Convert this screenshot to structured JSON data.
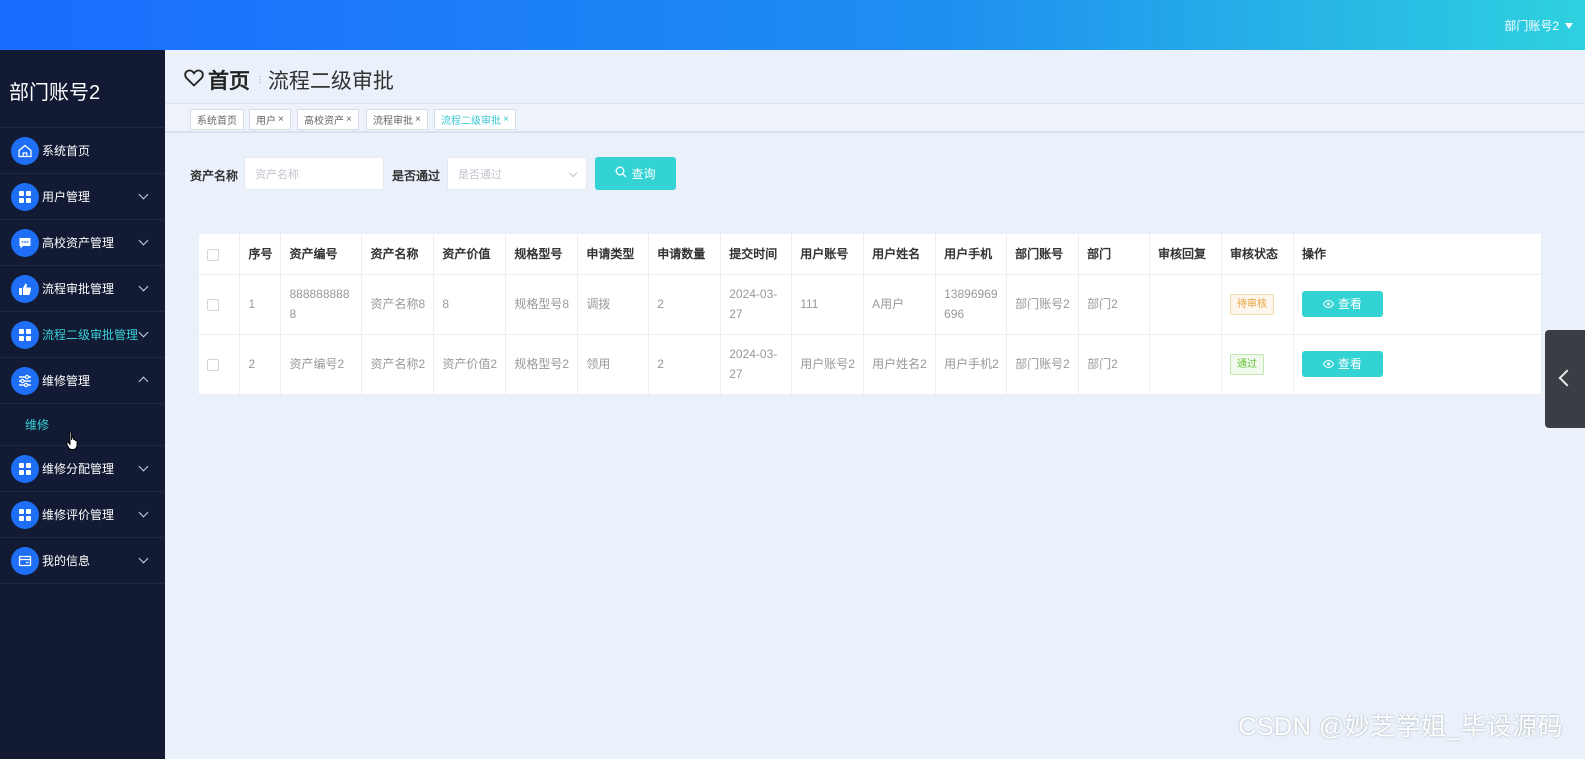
{
  "header": {
    "user": "部门账号2"
  },
  "sidebar": {
    "brand": "部门账号2",
    "items": [
      {
        "label": "系统首页",
        "icon": "home-icon"
      },
      {
        "label": "用户管理",
        "icon": "grid-icon"
      },
      {
        "label": "高校资产管理",
        "icon": "chat-icon"
      },
      {
        "label": "流程审批管理",
        "icon": "thumbs-up-icon"
      },
      {
        "label": "流程二级审批管理",
        "icon": "grid-icon"
      },
      {
        "label": "维修管理",
        "icon": "sliders-icon"
      },
      {
        "label": "维修分配管理",
        "icon": "grid-icon"
      },
      {
        "label": "维修评价管理",
        "icon": "grid-icon"
      },
      {
        "label": "我的信息",
        "icon": "card-icon"
      }
    ],
    "sub_item": "维修"
  },
  "breadcrumb": {
    "home": "首页",
    "current": "流程二级审批"
  },
  "tabs": [
    "系统首页",
    "用户",
    "高校资产",
    "流程审批",
    "流程二级审批"
  ],
  "search": {
    "asset_name_label": "资产名称",
    "asset_name_placeholder": "资产名称",
    "pass_label": "是否通过",
    "pass_placeholder": "是否通过",
    "query_label": "查询"
  },
  "table": {
    "columns": [
      "序号",
      "资产编号",
      "资产名称",
      "资产价值",
      "规格型号",
      "申请类型",
      "申请数量",
      "提交时间",
      "用户账号",
      "用户姓名",
      "用户手机",
      "部门账号",
      "部门",
      "审核回复",
      "审核状态",
      "操作"
    ],
    "rows": [
      {
        "no": "1",
        "asset_code": "8888888888",
        "asset_name": "资产名称8",
        "asset_value": "8",
        "spec": "规格型号8",
        "apply_type": "调拨",
        "qty": "2",
        "submit_time": "2024-03-27",
        "user_account": "111",
        "user_name": "A用户",
        "phone": "13896969696",
        "dept_account": "部门账号2",
        "dept": "部门2",
        "reply": "",
        "status": "待审核",
        "action": "查看"
      },
      {
        "no": "2",
        "asset_code": "资产编号2",
        "asset_name": "资产名称2",
        "asset_value": "资产价值2",
        "spec": "规格型号2",
        "apply_type": "领用",
        "qty": "2",
        "submit_time": "2024-03-27",
        "user_account": "用户账号2",
        "user_name": "用户姓名2",
        "phone": "用户手机2",
        "dept_account": "部门账号2",
        "dept": "部门2",
        "reply": "",
        "status": "通过",
        "action": "查看"
      }
    ]
  },
  "watermark": "CSDN @妙芝学姐_毕设源码",
  "colors": {
    "accent": "#33d3d4",
    "sidebar_bg": "#121a34",
    "icon_bg": "#1e6ff5"
  }
}
